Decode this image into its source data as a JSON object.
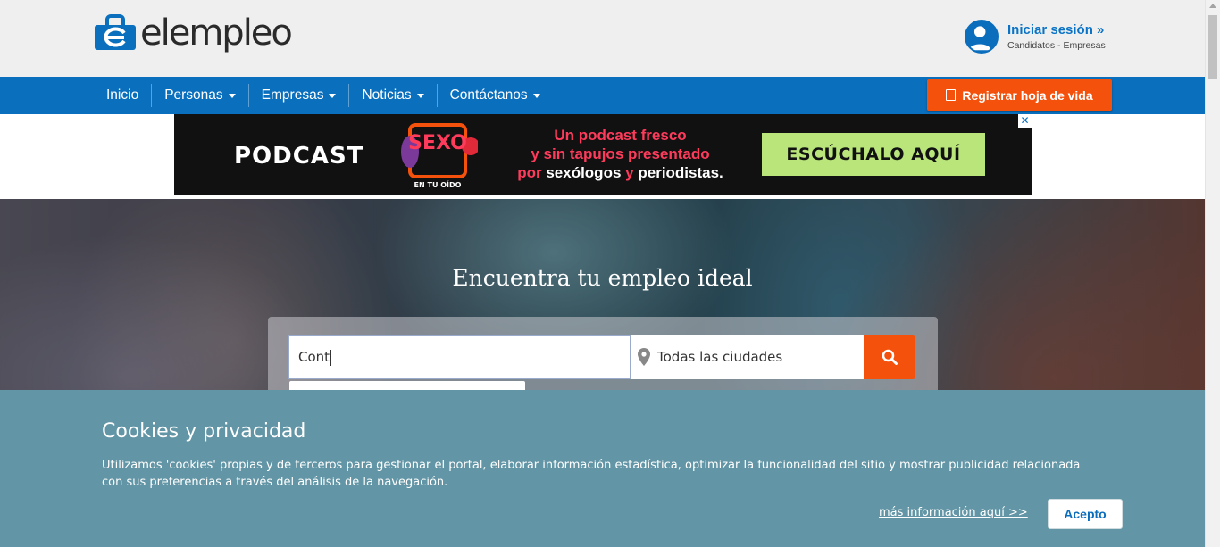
{
  "header": {
    "logo_text": "elempleo",
    "login_title": "Iniciar sesión »",
    "login_sub": "Candidatos - Empresas"
  },
  "nav": {
    "items": [
      {
        "label": "Inicio",
        "dropdown": false
      },
      {
        "label": "Personas",
        "dropdown": true
      },
      {
        "label": "Empresas",
        "dropdown": true
      },
      {
        "label": "Noticias",
        "dropdown": true
      },
      {
        "label": "Contáctanos",
        "dropdown": true
      }
    ],
    "register_label": "Registrar hoja de vida"
  },
  "ad": {
    "podcast": "PODCAST",
    "logo_word": "SEXO",
    "logo_tag": "EN TU OÍDO",
    "line1": "Un podcast fresco",
    "line2": "y sin tapujos presentado",
    "line3_a": "por",
    "line3_b": "sexólogos",
    "line3_c": "y",
    "line3_d": "periodistas.",
    "cta": "ESCÚCHALO AQUÍ",
    "close": "✕"
  },
  "hero": {
    "title": "Encuentra tu empleo ideal",
    "search_value": "Cont",
    "city_value": "Todas las ciudades"
  },
  "cookies": {
    "title": "Cookies y privacidad",
    "text": "Utilizamos 'cookies' propias y de terceros para gestionar el portal, elaborar información estadística, optimizar la funcionalidad del sitio y mostrar publicidad relacionada con sus preferencias a través del análisis de la navegación.",
    "link": "más información aquí >>",
    "accept": "Acepto"
  },
  "colors": {
    "brand_blue": "#0a6fbd",
    "accent_orange": "#f4520c",
    "cookie_bg": "#6295a5",
    "ad_cta_green": "#b9e57a"
  }
}
